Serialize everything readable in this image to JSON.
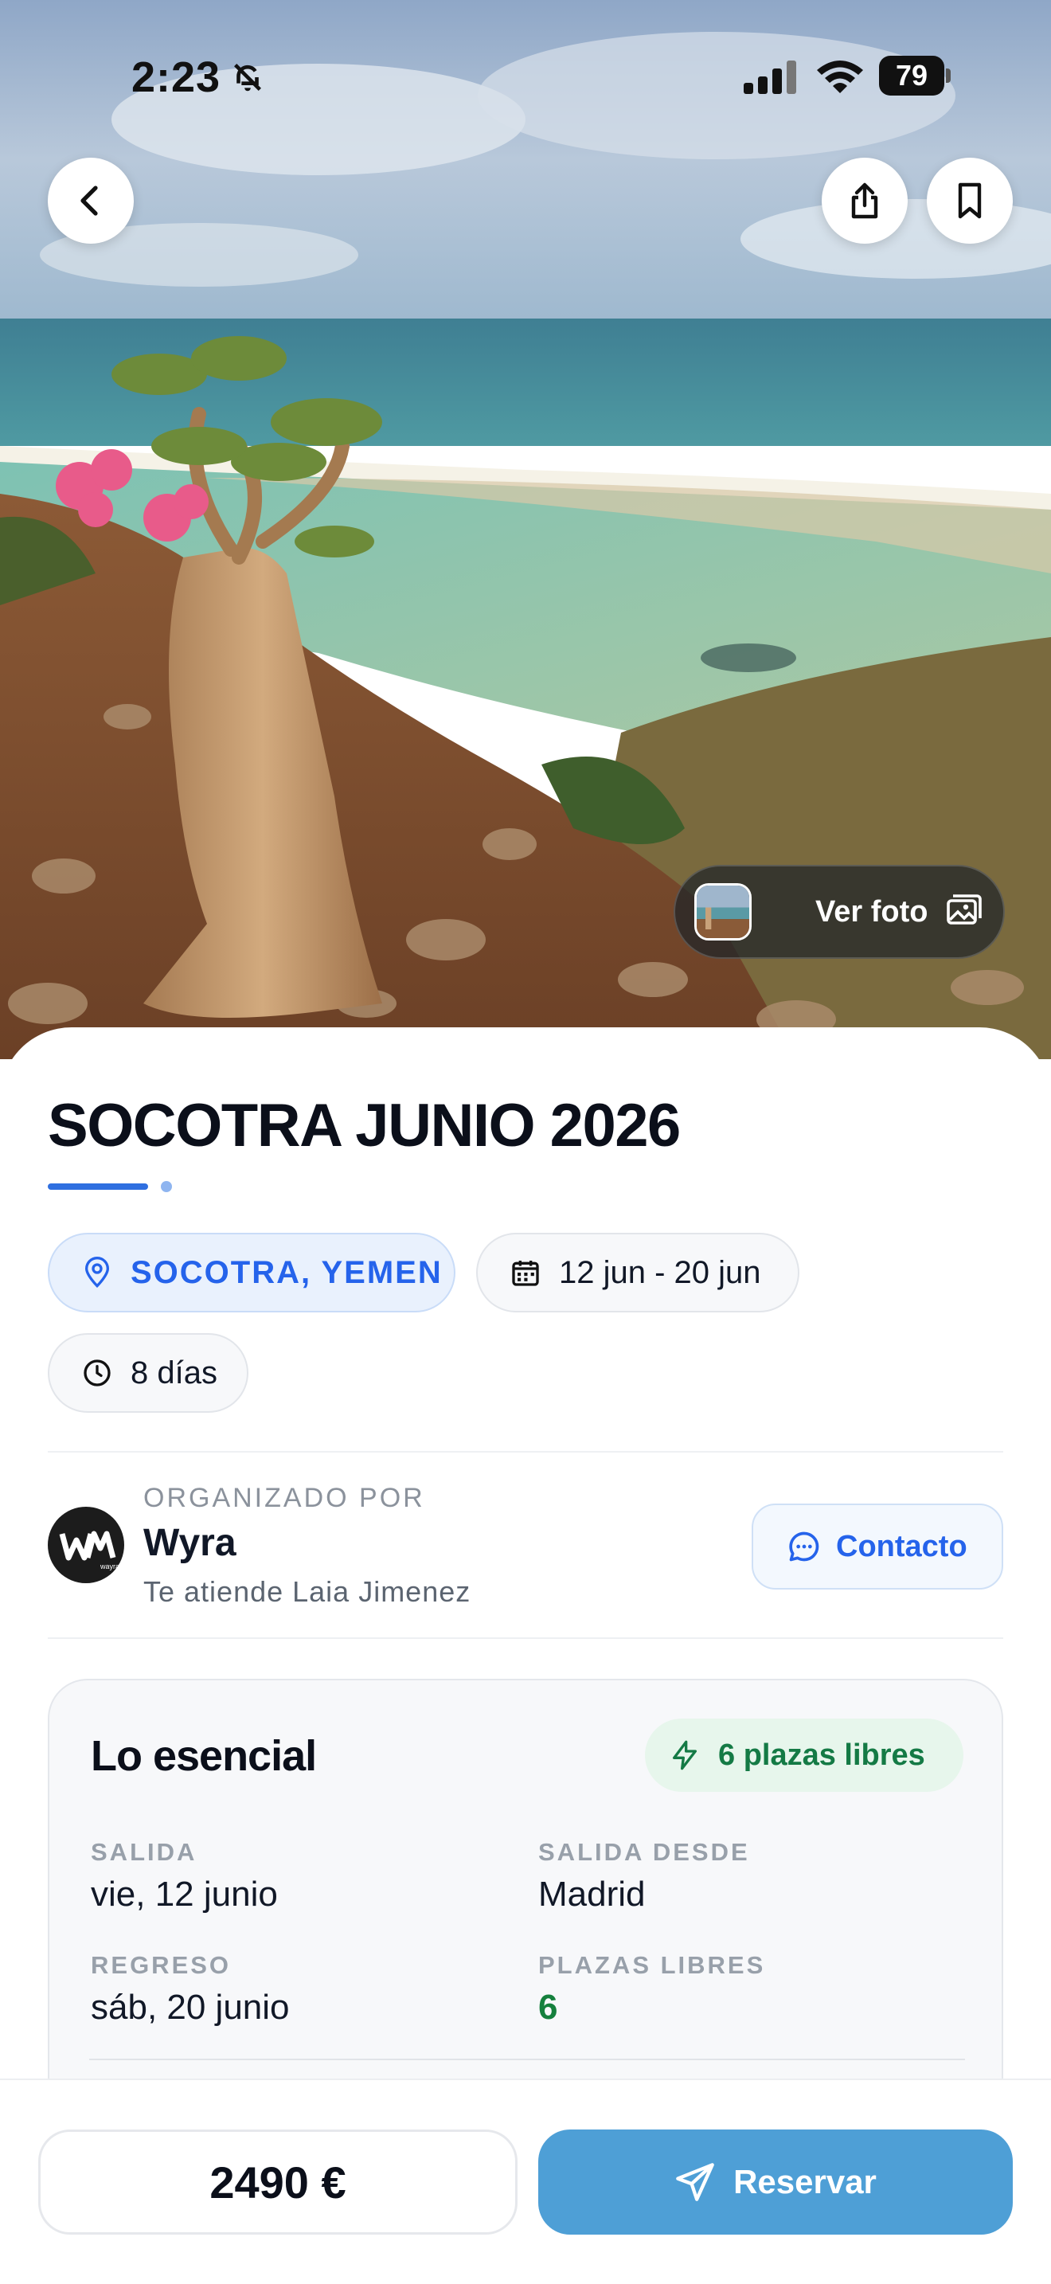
{
  "status_bar": {
    "time": "2:23",
    "battery": "79"
  },
  "hero": {
    "view_photo_label": "Ver foto"
  },
  "trip": {
    "title": "SOCOTRA JUNIO 2026",
    "location": "SOCOTRA, YEMEN",
    "dates": "12 jun - 20 jun",
    "duration": "8 días"
  },
  "organizer": {
    "label": "ORGANIZADO POR",
    "name": "Wyra",
    "agent": "Te atiende Laia Jimenez",
    "avatar_logo_text": "wayra",
    "contact_label": "Contacto"
  },
  "essentials": {
    "title": "Lo esencial",
    "seats_badge": "6 plazas libres",
    "departure_label": "SALIDA",
    "departure_value": "vie, 12 junio",
    "departure_from_label": "SALIDA DESDE",
    "departure_from_value": "Madrid",
    "return_label": "REGRESO",
    "return_value": "sáb, 20 junio",
    "free_seats_label": "PLAZAS LIBRES",
    "free_seats_value": "6"
  },
  "booking": {
    "price": "2490 €",
    "reserve_label": "Reservar"
  },
  "colors": {
    "accent_blue": "#2563eb",
    "reserve_button": "#4e9fd6",
    "green": "#15803d",
    "badge_green_bg": "#e7f6ec"
  },
  "icons": {
    "back": "chevron-left-icon",
    "share": "share-icon",
    "bookmark": "bookmark-icon",
    "location": "map-pin-icon",
    "calendar": "calendar-icon",
    "clock": "clock-icon",
    "chat": "chat-bubble-icon",
    "bolt": "lightning-icon",
    "send": "paper-plane-icon",
    "image": "image-gallery-icon"
  }
}
